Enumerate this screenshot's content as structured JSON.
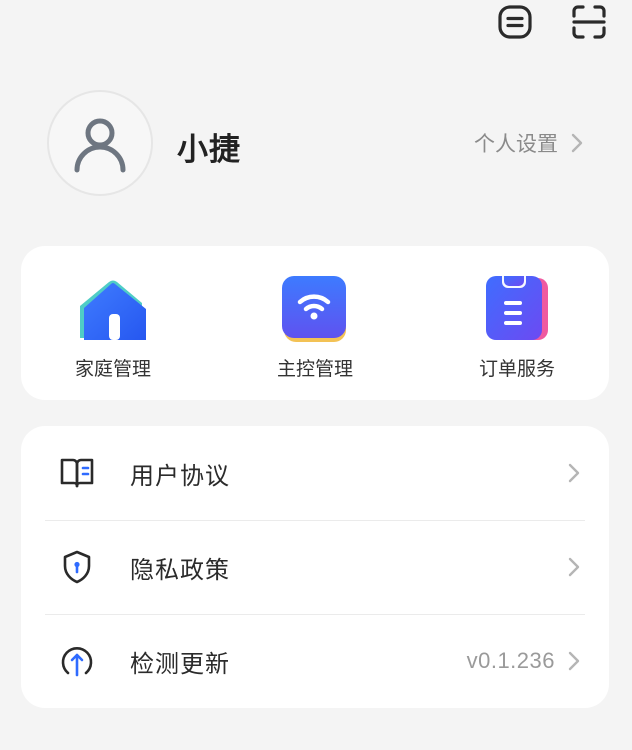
{
  "header": {
    "icons": [
      "message-icon",
      "scan-icon"
    ]
  },
  "profile": {
    "username": "小捷",
    "settings_label": "个人设置",
    "avatar_icon": "person-icon"
  },
  "quick_actions": [
    {
      "label": "家庭管理",
      "icon": "home-icon"
    },
    {
      "label": "主控管理",
      "icon": "wifi-icon"
    },
    {
      "label": "订单服务",
      "icon": "order-clipboard-icon"
    }
  ],
  "menu": [
    {
      "label": "用户协议",
      "icon": "book-icon",
      "value": ""
    },
    {
      "label": "隐私政策",
      "icon": "shield-icon",
      "value": ""
    },
    {
      "label": "检测更新",
      "icon": "update-arrow-icon",
      "value": "v0.1.236"
    }
  ],
  "colors": {
    "background": "#f4f4f4",
    "card": "#ffffff",
    "accent_blue": "#2f6bff",
    "accent_purple": "#6b4cf5",
    "icon_gray": "#6e7681"
  }
}
